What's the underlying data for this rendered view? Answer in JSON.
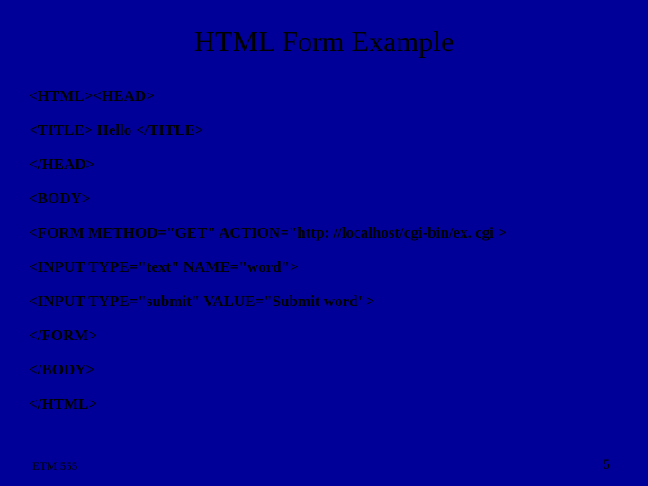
{
  "slide": {
    "title": "HTML Form Example",
    "code_lines": [
      "<HTML><HEAD>",
      "<TITLE> Hello </TITLE>",
      "</HEAD>",
      "<BODY>",
      "<FORM  METHOD=\"GET\"  ACTION=\"http: //localhost/cgi-bin/ex. cgi >",
      "<INPUT TYPE=\"text\" NAME=\"word\">",
      "<INPUT TYPE=\"submit\" VALUE=\"Submit word\">",
      "</FORM>",
      "</BODY>",
      "</HTML>"
    ],
    "footer_left": "ETM 555",
    "footer_right": "5"
  }
}
